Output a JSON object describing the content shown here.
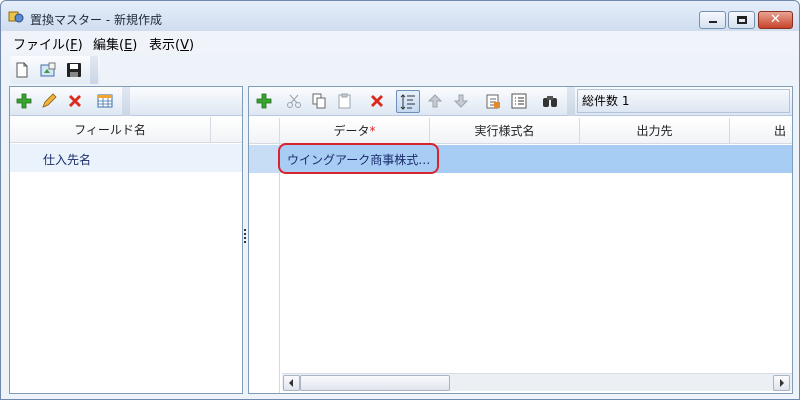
{
  "window": {
    "title": "置換マスター - 新規作成",
    "controls": {
      "minimize": "minimize",
      "maximize": "maximize",
      "close": "✕"
    }
  },
  "menu": [
    {
      "label": "ファイル(",
      "key": "F",
      "suffix": ")"
    },
    {
      "label": "編集(",
      "key": "E",
      "suffix": ")"
    },
    {
      "label": "表示(",
      "key": "V",
      "suffix": ")"
    }
  ],
  "top_toolbar": {
    "icons": [
      "new-document-icon",
      "open-icon",
      "save-icon"
    ]
  },
  "left_pane": {
    "toolbar_icons": [
      "add-icon",
      "edit-pencil-icon",
      "delete-icon",
      "table-icon"
    ],
    "columns": [
      "フィールド名"
    ],
    "rows": [
      {
        "field_name": "仕入先名",
        "selected": true
      }
    ]
  },
  "right_pane": {
    "toolbar_icons": [
      "add-icon",
      "cut-icon",
      "copy-icon",
      "paste-icon",
      "delete-icon",
      "sort-icon",
      "up-arrow-icon",
      "down-arrow-icon",
      "export-icon",
      "list-icon",
      "binoculars-icon"
    ],
    "record_count_label": "総件数 1",
    "columns": [
      "データ",
      "実行様式名",
      "出力先",
      "出力"
    ],
    "required_marker": "*",
    "rows": [
      {
        "data": "ウイングアーク商事株式…",
        "style": "",
        "output": ""
      }
    ]
  },
  "colors": {
    "selection": "#a8cdf5",
    "highlight_circle": "#d8242e",
    "required": "#d8242e"
  }
}
